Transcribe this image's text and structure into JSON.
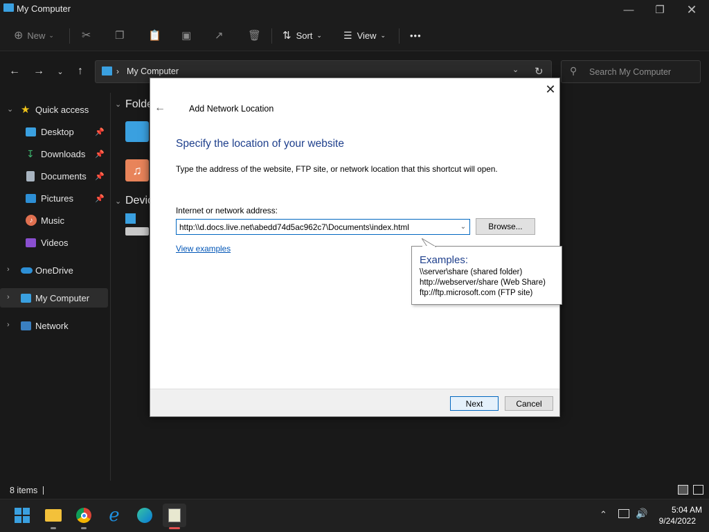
{
  "window": {
    "title": "My Computer"
  },
  "commandbar": {
    "new": "New",
    "sort": "Sort",
    "view": "View",
    "more": "•••"
  },
  "addressbar": {
    "location": "My Computer",
    "search_placeholder": "Search My Computer"
  },
  "sidebar": {
    "items": [
      {
        "label": "Quick access"
      },
      {
        "label": "Desktop"
      },
      {
        "label": "Downloads"
      },
      {
        "label": "Documents"
      },
      {
        "label": "Pictures"
      },
      {
        "label": "Music"
      },
      {
        "label": "Videos"
      },
      {
        "label": "OneDrive"
      },
      {
        "label": "My Computer"
      },
      {
        "label": "Network"
      }
    ]
  },
  "main": {
    "group_folders": "Folde",
    "group_devices": "Devic"
  },
  "status": {
    "items": "8 items"
  },
  "taskbar": {
    "time": "5:04 AM",
    "date": "9/24/2022"
  },
  "dialog": {
    "title": "Add Network Location",
    "heading": "Specify the location of your website",
    "description": "Type the address of the website, FTP site, or network location that this shortcut will open.",
    "address_label": "Internet or network address:",
    "address_value": "http:\\\\d.docs.live.net\\abedd74d5ac962c7\\Documents\\index.html",
    "browse": "Browse...",
    "view_examples": "View examples",
    "tooltip": {
      "title": "Examples:",
      "lines": [
        "\\\\server\\share   (shared folder)",
        "http://webserver/share   (Web Share)",
        "ftp://ftp.microsoft.com   (FTP site)"
      ]
    },
    "next": "Next",
    "cancel": "Cancel"
  },
  "colors": {
    "accent": "#0067c0",
    "heading": "#1e3f8c",
    "link": "#0055b6"
  }
}
